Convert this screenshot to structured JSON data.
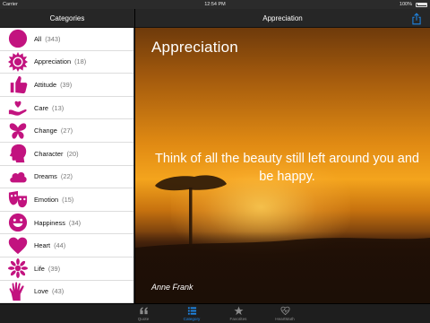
{
  "status_bar": {
    "carrier": "Carrier",
    "time": "12:54 PM",
    "battery": "100%"
  },
  "left_panel": {
    "title": "Categories",
    "items": [
      {
        "label": "All",
        "count": "(343)",
        "icon": "circle-icon"
      },
      {
        "label": "Appreciation",
        "count": "(18)",
        "icon": "sun-badge-icon"
      },
      {
        "label": "Attitude",
        "count": "(39)",
        "icon": "thumbs-up-icon"
      },
      {
        "label": "Care",
        "count": "(13)",
        "icon": "heart-hand-icon"
      },
      {
        "label": "Change",
        "count": "(27)",
        "icon": "butterfly-icon"
      },
      {
        "label": "Character",
        "count": "(20)",
        "icon": "head-profile-icon"
      },
      {
        "label": "Dreams",
        "count": "(22)",
        "icon": "cloud-icon"
      },
      {
        "label": "Emotion",
        "count": "(15)",
        "icon": "masks-icon"
      },
      {
        "label": "Happiness",
        "count": "(34)",
        "icon": "smiley-icon"
      },
      {
        "label": "Heart",
        "count": "(44)",
        "icon": "heart-icon"
      },
      {
        "label": "Life",
        "count": "(39)",
        "icon": "flower-icon"
      },
      {
        "label": "Love",
        "count": "(43)",
        "icon": "hand-icon"
      }
    ]
  },
  "right_panel": {
    "title": "Appreciation",
    "heading": "Appreciation",
    "quote": "Think of all the beauty still left around you and be happy.",
    "author": "Anne Frank"
  },
  "tab_bar": {
    "tabs": [
      {
        "label": "Quote",
        "icon": "quote-icon",
        "active": false
      },
      {
        "label": "Category",
        "icon": "list-icon",
        "active": true
      },
      {
        "label": "Favorites",
        "icon": "star-icon",
        "active": false
      },
      {
        "label": "HeartMath",
        "icon": "heartbeat-icon",
        "active": false
      }
    ]
  },
  "colors": {
    "icon_magenta": "#c2137f",
    "tab_active": "#1e86e6",
    "bar_bg": "#262626"
  }
}
